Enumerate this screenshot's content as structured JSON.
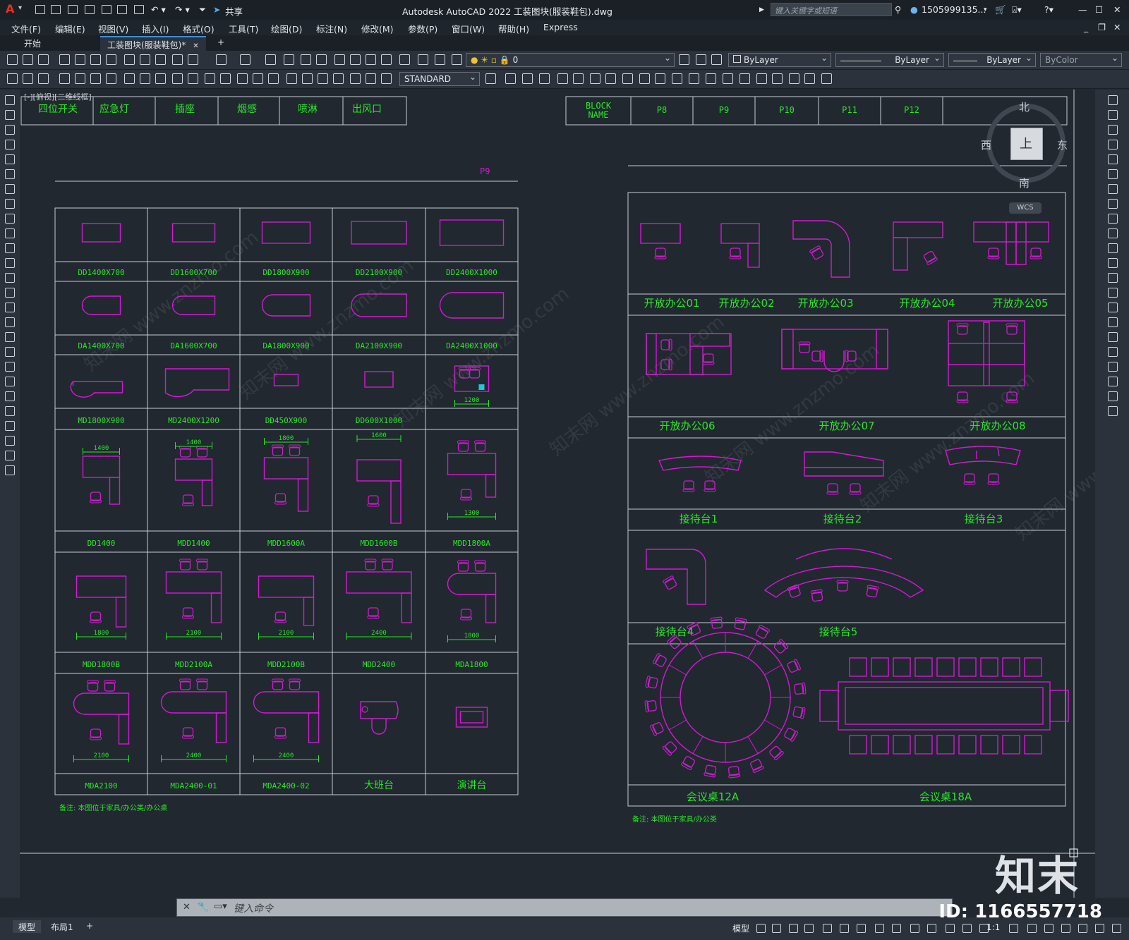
{
  "titlebar": {
    "app_logo": "A",
    "share_label": "共享",
    "title": "Autodesk AutoCAD 2022    工装图块(服装鞋包).dwg",
    "search_placeholder": "键入关键字或短语",
    "user": "1505999135...",
    "min": "—",
    "max": "☐",
    "close": "✕"
  },
  "menu": [
    "文件(F)",
    "编辑(E)",
    "视图(V)",
    "插入(I)",
    "格式(O)",
    "工具(T)",
    "绘图(D)",
    "标注(N)",
    "修改(M)",
    "参数(P)",
    "窗口(W)",
    "帮助(H)",
    "Express"
  ],
  "tabs": {
    "start": "开始",
    "active": "工装图块(服装鞋包)*",
    "close": "✕",
    "add": "+"
  },
  "toolbar": {
    "layer": "0",
    "color": "ByLayer",
    "linetype": "ByLayer",
    "lineweight": "ByLayer",
    "plotstyle": "ByColor",
    "textstyle": "STANDARD"
  },
  "viewport_label": "[-][俯视][二维线框]",
  "viewcube": {
    "north": "北",
    "south": "南",
    "east": "东",
    "west": "西",
    "top": "上",
    "wcs": "WCS"
  },
  "legend_left": [
    "四位开关",
    "应急灯",
    "插座",
    "烟感",
    "喷淋",
    "出风口"
  ],
  "legend_right": {
    "block_name": [
      "BLOCK",
      "NAME"
    ],
    "cols": [
      "P8",
      "P9",
      "P10",
      "P11",
      "P12"
    ]
  },
  "section_label": "P9",
  "left_grid": {
    "rows": [
      [
        "DD1400X700",
        "DD1600X700",
        "DD1800X900",
        "DD2100X900",
        "DD2400X1000"
      ],
      [
        "DA1400X700",
        "DA1600X700",
        "DA1800X900",
        "DA2100X900",
        "DA2400X1000"
      ],
      [
        "MD1800X900",
        "MD2400X1200",
        "DD450X900",
        "DD600X1000",
        ""
      ],
      [
        "DD1400",
        "MDD1400",
        "MDD1600A",
        "MDD1600B",
        "MDD1800A"
      ],
      [
        "MDD1800B",
        "MDD2100A",
        "MDD2100B",
        "MDD2400",
        "MDA1800"
      ],
      [
        "MDA2100",
        "MDA2400-01",
        "MDA2400-02",
        "大班台",
        "演讲台"
      ]
    ],
    "dims": {
      "r2c4": "1200",
      "r3": [
        "1400",
        "1400",
        "1800",
        "1600",
        "1300"
      ],
      "r4": [
        "1800",
        "2100",
        "2100",
        "2400",
        "1800"
      ],
      "r5": [
        "2100",
        "2400",
        "2400"
      ]
    },
    "note": "备注: 本图位于家具/办公类/办公桌"
  },
  "right_panel": {
    "row1": [
      "开放办公01",
      "开放办公02",
      "开放办公03",
      "开放办公04",
      "开放办公05"
    ],
    "row2": [
      "开放办公06",
      "开放办公07",
      "开放办公08"
    ],
    "row3": [
      "接待台1",
      "接待台2",
      "接待台3"
    ],
    "row4": [
      "接待台4",
      "接待台5"
    ],
    "row5": [
      "会议桌12A",
      "会议桌18A"
    ],
    "note": "备注: 本图位于家具/办公类"
  },
  "command": {
    "placeholder": "键入命令"
  },
  "status": {
    "model_tab": "模型",
    "layout_tab": "布局1",
    "add": "+",
    "model_btn": "模型",
    "scale": "1:1"
  },
  "watermark": {
    "logo": "知末",
    "id": "ID: 1166557718",
    "site": "知末网 www.znzmo.com"
  },
  "colors": {
    "magenta": "#d21ad2",
    "green": "#25e825",
    "line": "#c8ccd2",
    "bg": "#212830"
  }
}
